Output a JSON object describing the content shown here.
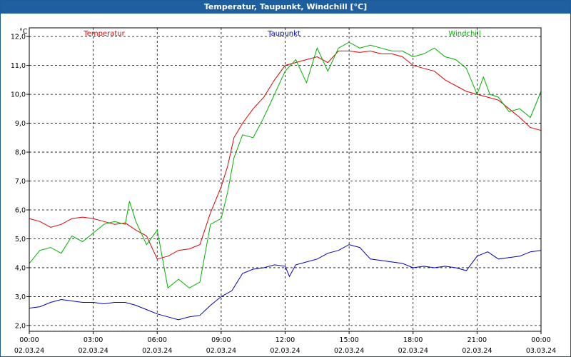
{
  "window": {
    "title": "Temperatur, Taupunkt, Windchill [°C]"
  },
  "chart_data": {
    "type": "line",
    "title": "Temperatur, Taupunkt, Windchill [°C]",
    "ylabel": "°C",
    "ylim": [
      1.8,
      12.3
    ],
    "y_ticks": [
      "2,0",
      "3,0",
      "4,0",
      "5,0",
      "6,0",
      "7,0",
      "8,0",
      "9,0",
      "10,0",
      "11,0",
      "12,0"
    ],
    "x_ticks": [
      {
        "time": "00:00",
        "date": "02.03.24"
      },
      {
        "time": "03:00",
        "date": "02.03.24"
      },
      {
        "time": "06:00",
        "date": "02.03.24"
      },
      {
        "time": "09:00",
        "date": "02.03.24"
      },
      {
        "time": "12:00",
        "date": "02.03.24"
      },
      {
        "time": "15:00",
        "date": "02.03.24"
      },
      {
        "time": "18:00",
        "date": "02.03.24"
      },
      {
        "time": "21:00",
        "date": "02.03.24"
      },
      {
        "time": "00:00",
        "date": "03.03.24"
      }
    ],
    "grid": true,
    "series": [
      {
        "name": "Temperatur",
        "color": "#e00000",
        "points": [
          [
            0,
            5.7
          ],
          [
            0.5,
            5.6
          ],
          [
            1,
            5.4
          ],
          [
            1.5,
            5.5
          ],
          [
            2,
            5.7
          ],
          [
            2.5,
            5.75
          ],
          [
            3,
            5.7
          ],
          [
            3.5,
            5.6
          ],
          [
            4,
            5.5
          ],
          [
            4.5,
            5.55
          ],
          [
            5,
            5.3
          ],
          [
            5.5,
            5.1
          ],
          [
            6,
            4.3
          ],
          [
            6.5,
            4.4
          ],
          [
            7,
            4.6
          ],
          [
            7.5,
            4.65
          ],
          [
            8,
            4.8
          ],
          [
            8.5,
            5.9
          ],
          [
            9,
            6.8
          ],
          [
            9.3,
            7.5
          ],
          [
            9.6,
            8.5
          ],
          [
            10,
            9.0
          ],
          [
            10.5,
            9.5
          ],
          [
            11,
            9.9
          ],
          [
            11.5,
            10.5
          ],
          [
            12,
            11.0
          ],
          [
            12.5,
            11.1
          ],
          [
            13,
            11.2
          ],
          [
            13.5,
            11.3
          ],
          [
            14,
            11.1
          ],
          [
            14.5,
            11.5
          ],
          [
            15,
            11.5
          ],
          [
            15.5,
            11.45
          ],
          [
            16,
            11.5
          ],
          [
            16.5,
            11.4
          ],
          [
            17,
            11.4
          ],
          [
            17.5,
            11.3
          ],
          [
            18,
            11.0
          ],
          [
            18.5,
            10.9
          ],
          [
            19,
            10.8
          ],
          [
            19.5,
            10.5
          ],
          [
            20,
            10.3
          ],
          [
            20.5,
            10.1
          ],
          [
            21,
            10.0
          ],
          [
            21.5,
            9.9
          ],
          [
            22,
            9.8
          ],
          [
            22.5,
            9.5
          ],
          [
            23,
            9.2
          ],
          [
            23.5,
            8.85
          ],
          [
            24,
            8.75
          ]
        ]
      },
      {
        "name": "Taupunkt",
        "color": "#0000c0",
        "points": [
          [
            0,
            2.6
          ],
          [
            0.5,
            2.65
          ],
          [
            1,
            2.8
          ],
          [
            1.5,
            2.9
          ],
          [
            2,
            2.85
          ],
          [
            2.5,
            2.8
          ],
          [
            3,
            2.8
          ],
          [
            3.5,
            2.75
          ],
          [
            4,
            2.8
          ],
          [
            4.5,
            2.8
          ],
          [
            5,
            2.7
          ],
          [
            5.5,
            2.55
          ],
          [
            6,
            2.4
          ],
          [
            6.5,
            2.3
          ],
          [
            7,
            2.2
          ],
          [
            7.5,
            2.3
          ],
          [
            8,
            2.35
          ],
          [
            8.5,
            2.7
          ],
          [
            9,
            3.0
          ],
          [
            9.5,
            3.2
          ],
          [
            10,
            3.8
          ],
          [
            10.5,
            3.95
          ],
          [
            11,
            4.0
          ],
          [
            11.5,
            4.1
          ],
          [
            12,
            4.05
          ],
          [
            12.2,
            3.7
          ],
          [
            12.5,
            4.1
          ],
          [
            13,
            4.2
          ],
          [
            13.5,
            4.3
          ],
          [
            14,
            4.5
          ],
          [
            14.5,
            4.6
          ],
          [
            15,
            4.8
          ],
          [
            15.5,
            4.7
          ],
          [
            16,
            4.3
          ],
          [
            16.5,
            4.25
          ],
          [
            17,
            4.2
          ],
          [
            17.5,
            4.15
          ],
          [
            18,
            4.0
          ],
          [
            18.5,
            4.05
          ],
          [
            19,
            4.0
          ],
          [
            19.5,
            4.05
          ],
          [
            20,
            4.0
          ],
          [
            20.5,
            3.9
          ],
          [
            21,
            4.4
          ],
          [
            21.5,
            4.55
          ],
          [
            22,
            4.3
          ],
          [
            22.5,
            4.35
          ],
          [
            23,
            4.4
          ],
          [
            23.5,
            4.55
          ],
          [
            24,
            4.6
          ]
        ]
      },
      {
        "name": "Windchill",
        "color": "#00b000",
        "points": [
          [
            0,
            4.15
          ],
          [
            0.5,
            4.6
          ],
          [
            1,
            4.7
          ],
          [
            1.5,
            4.5
          ],
          [
            2,
            5.1
          ],
          [
            2.5,
            4.9
          ],
          [
            3,
            5.2
          ],
          [
            3.5,
            5.5
          ],
          [
            4,
            5.6
          ],
          [
            4.5,
            5.5
          ],
          [
            4.7,
            6.3
          ],
          [
            5,
            5.6
          ],
          [
            5.5,
            4.8
          ],
          [
            6,
            5.3
          ],
          [
            6.5,
            3.3
          ],
          [
            7,
            3.6
          ],
          [
            7.5,
            3.3
          ],
          [
            8,
            3.5
          ],
          [
            8.5,
            5.5
          ],
          [
            9,
            5.7
          ],
          [
            9.3,
            6.6
          ],
          [
            9.6,
            7.8
          ],
          [
            10,
            8.6
          ],
          [
            10.5,
            8.5
          ],
          [
            11,
            9.2
          ],
          [
            11.5,
            10.0
          ],
          [
            12,
            10.8
          ],
          [
            12.5,
            11.2
          ],
          [
            13,
            10.4
          ],
          [
            13.5,
            11.6
          ],
          [
            14,
            10.8
          ],
          [
            14.5,
            11.6
          ],
          [
            15,
            11.8
          ],
          [
            15.5,
            11.6
          ],
          [
            16,
            11.7
          ],
          [
            16.5,
            11.6
          ],
          [
            17,
            11.5
          ],
          [
            17.5,
            11.5
          ],
          [
            18,
            11.3
          ],
          [
            18.5,
            11.4
          ],
          [
            19,
            11.6
          ],
          [
            19.5,
            11.3
          ],
          [
            20,
            11.2
          ],
          [
            20.5,
            10.9
          ],
          [
            21,
            10.0
          ],
          [
            21.3,
            10.6
          ],
          [
            21.6,
            10.0
          ],
          [
            22,
            9.9
          ],
          [
            22.5,
            9.4
          ],
          [
            23,
            9.5
          ],
          [
            23.5,
            9.2
          ],
          [
            24,
            10.1
          ]
        ]
      }
    ]
  }
}
